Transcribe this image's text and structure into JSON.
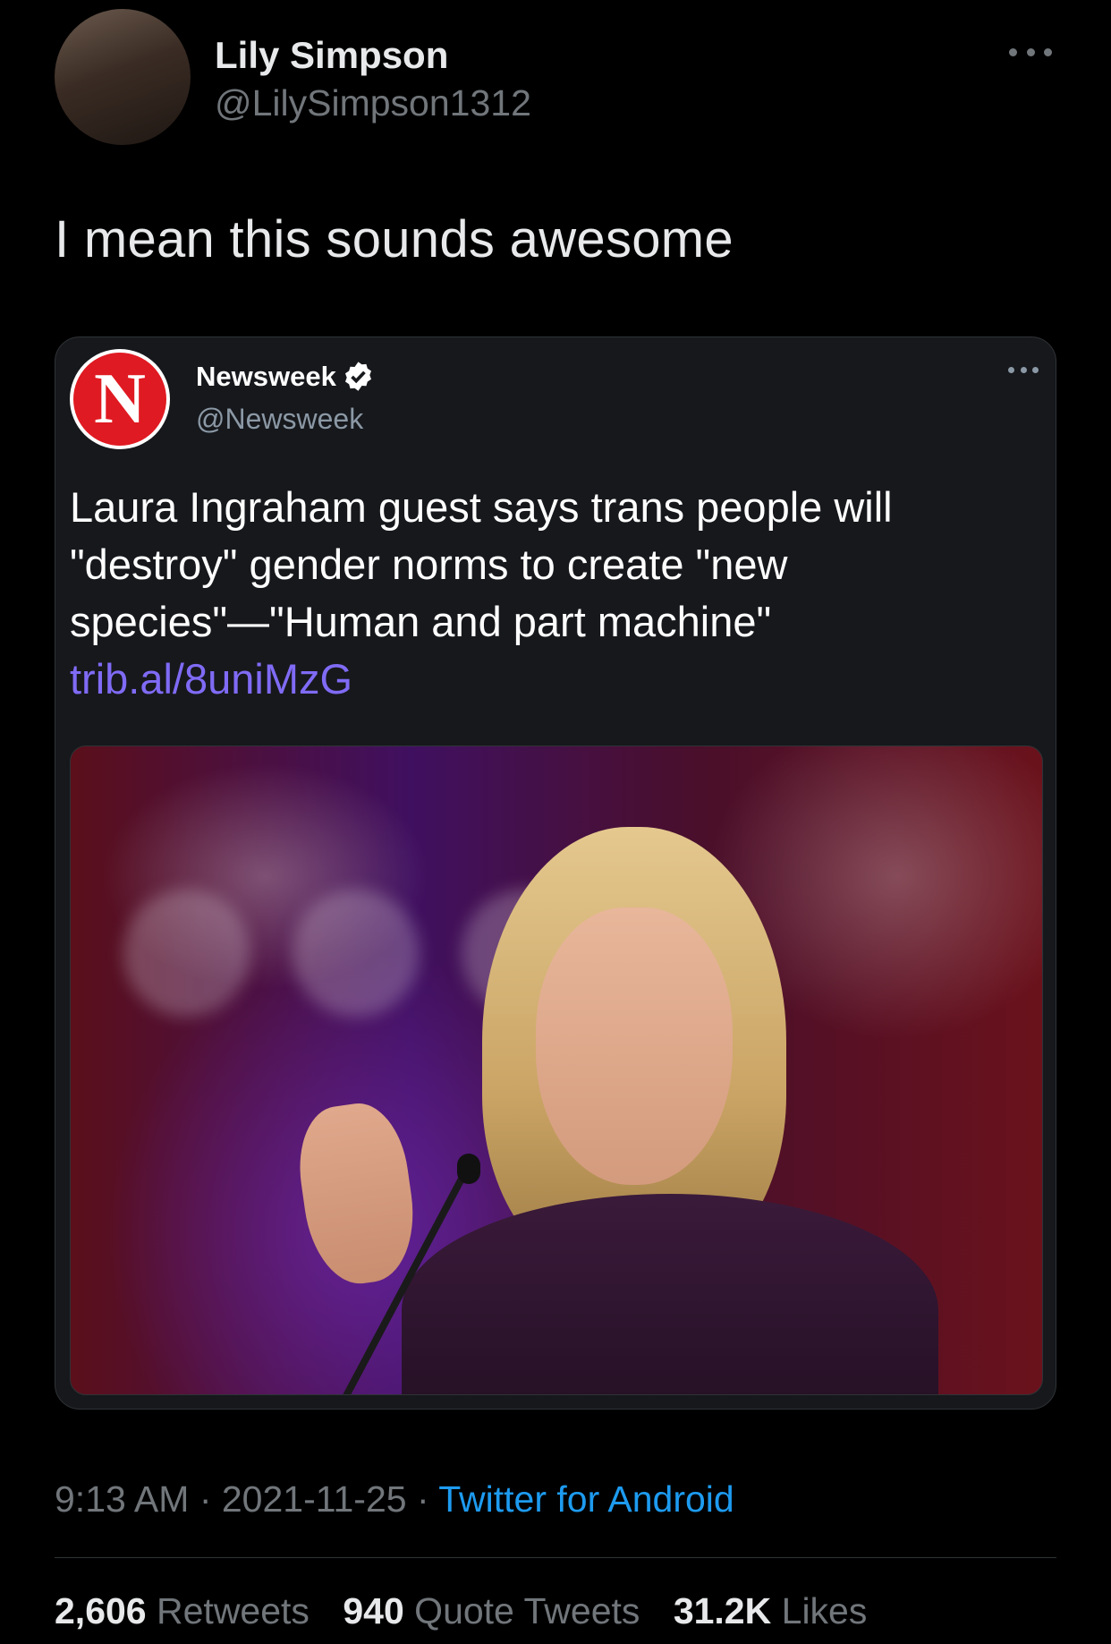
{
  "tweet": {
    "author_name": "Lily Simpson",
    "author_handle": "@LilySimpson1312",
    "text": "I mean this sounds awesome"
  },
  "quoted": {
    "author_name": "Newsweek",
    "author_handle": "@Newsweek",
    "logo_letter": "N",
    "text": "Laura Ingraham guest says trans people will \"destroy\" gender norms to create \"new species\"—\"Human and part machine\"",
    "link": "trib.al/8uniMzG"
  },
  "meta": {
    "time": "9:13 AM",
    "sep1": " · ",
    "date": "2021-11-25",
    "sep2": " · ",
    "source": "Twitter for Android"
  },
  "stats": {
    "retweets_count": "2,606",
    "retweets_label": "Retweets",
    "quotes_count": "940",
    "quotes_label": "Quote Tweets",
    "likes_count": "31.2K",
    "likes_label": "Likes"
  },
  "colors": {
    "background": "#000000",
    "link_purple": "#7f6bf5",
    "link_blue": "#1d9bf0",
    "newsweek_red": "#e01a22"
  }
}
